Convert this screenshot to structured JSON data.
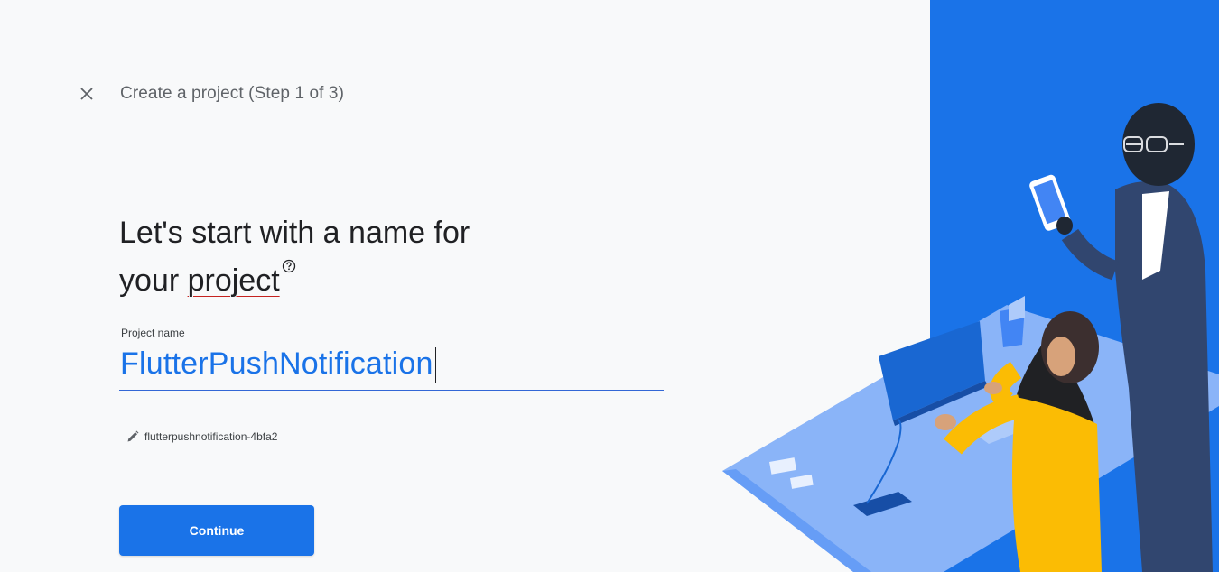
{
  "header": {
    "title": "Create a project (Step 1 of 3)"
  },
  "main": {
    "heading_line1": "Let's start with a name for",
    "heading_line2_prefix": "your ",
    "heading_line2_word": "project"
  },
  "form": {
    "project_name_label": "Project name",
    "project_name_value": "FlutterPushNotification",
    "project_id": "flutterpushnotification-4bfa2"
  },
  "actions": {
    "continue_label": "Continue"
  },
  "colors": {
    "accent": "#1a73e8",
    "illustration_blue": "#1a73e8",
    "background": "#f8f9fa"
  }
}
